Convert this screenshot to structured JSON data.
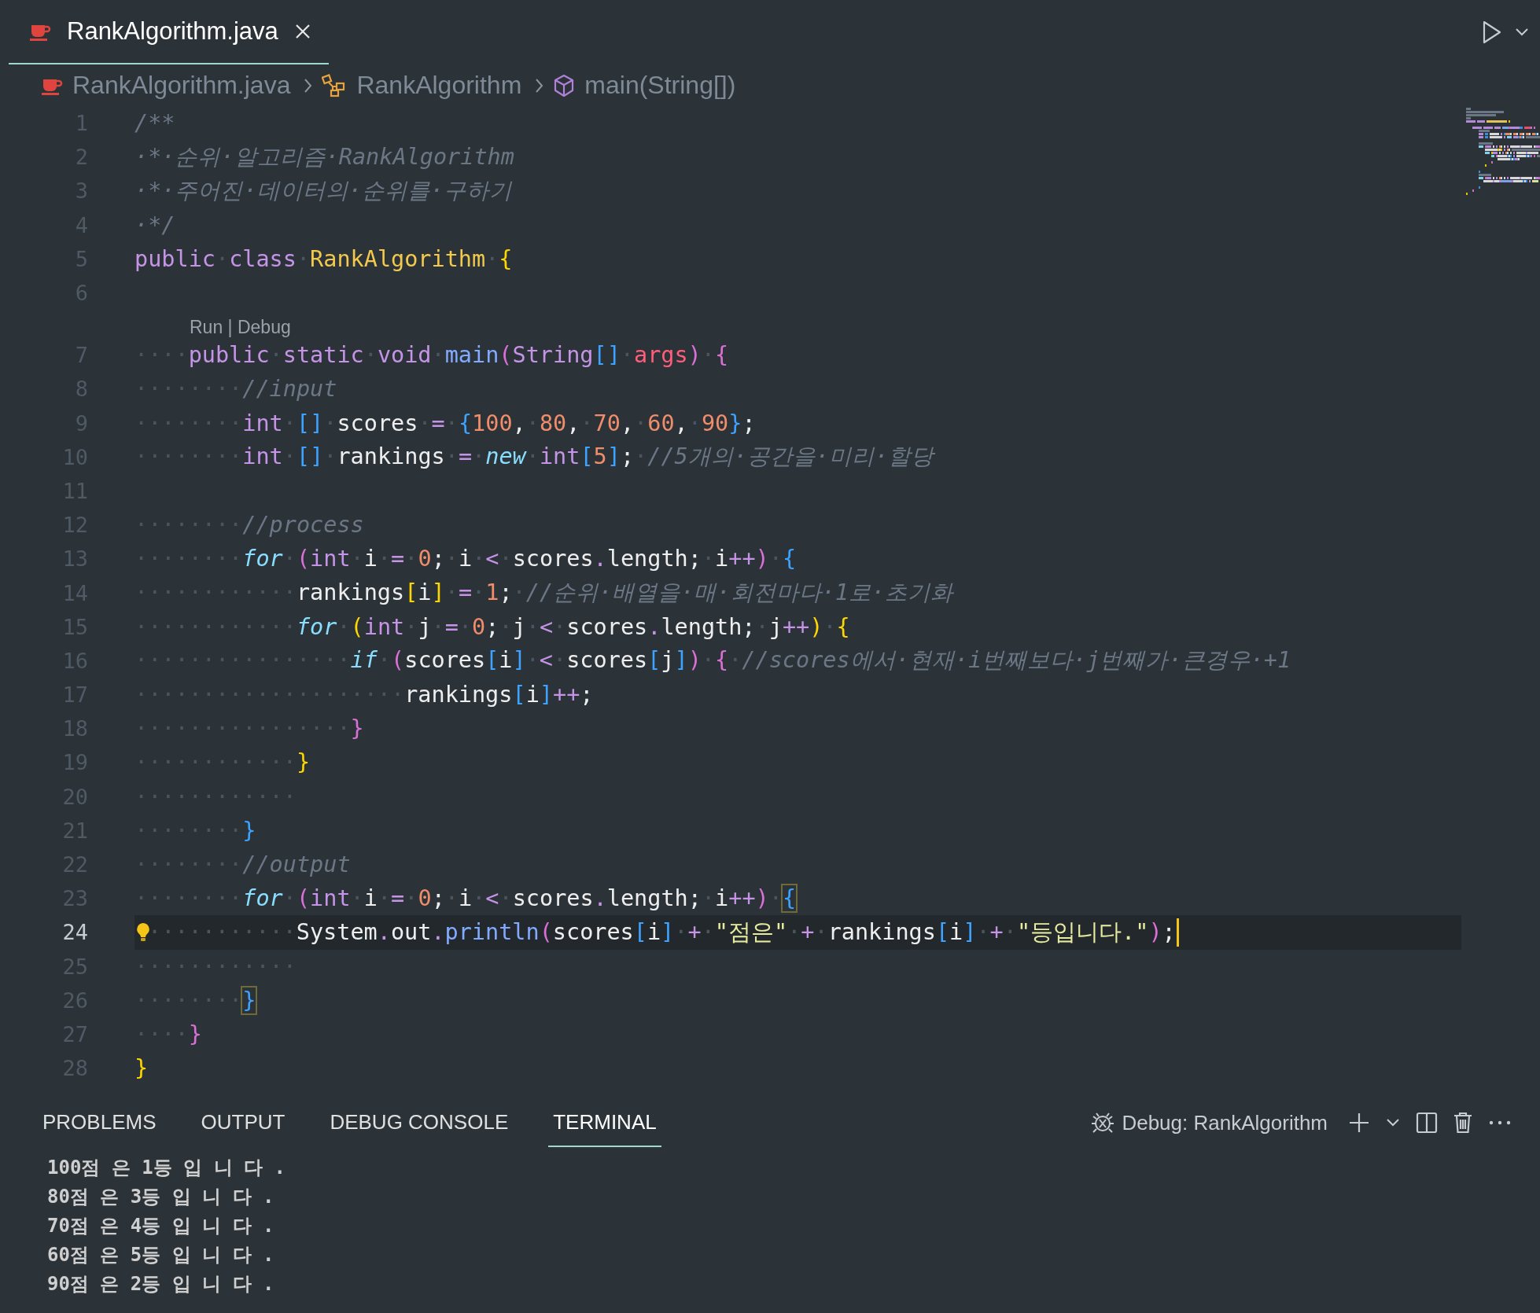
{
  "editor_tab": {
    "label": "RankAlgorithm.java",
    "selected": true
  },
  "breadcrumbs": [
    {
      "kind": "file",
      "label": "RankAlgorithm.java"
    },
    {
      "kind": "class",
      "label": "RankAlgorithm"
    },
    {
      "kind": "method",
      "label": "main(String[])"
    }
  ],
  "code_lines": [
    {
      "number": "1",
      "current": false,
      "tokens": [
        {
          "kind": "cm",
          "text": "/**"
        }
      ]
    },
    {
      "number": "2",
      "current": false,
      "tokens": [
        {
          "kind": "cm",
          "text": "·*·순위·알고리즘·RankAlgorithm"
        }
      ]
    },
    {
      "number": "3",
      "current": false,
      "tokens": [
        {
          "kind": "cm",
          "text": "·*·주어진·데이터의·순위를·구하기"
        }
      ]
    },
    {
      "number": "4",
      "current": false,
      "tokens": [
        {
          "kind": "cm",
          "text": "·*/"
        }
      ]
    },
    {
      "number": "5",
      "current": false,
      "tokens": [
        {
          "kind": "kw",
          "text": "public"
        },
        {
          "kind": "ws",
          "text": "·"
        },
        {
          "kind": "kw",
          "text": "class"
        },
        {
          "kind": "ws",
          "text": "·"
        },
        {
          "kind": "cls",
          "text": "RankAlgorithm"
        },
        {
          "kind": "ws",
          "text": "·"
        },
        {
          "kind": "b1",
          "text": "{"
        }
      ]
    },
    {
      "number": "6",
      "current": false
    },
    {
      "number": "7",
      "current": false,
      "codelens": "Run | Debug",
      "tokens": [
        {
          "kind": "ws",
          "text": "····"
        },
        {
          "kind": "kw",
          "text": "public"
        },
        {
          "kind": "ws",
          "text": "·"
        },
        {
          "kind": "kw",
          "text": "static"
        },
        {
          "kind": "ws",
          "text": "·"
        },
        {
          "kind": "kw",
          "text": "void"
        },
        {
          "kind": "ws",
          "text": "·"
        },
        {
          "kind": "fn",
          "text": "main"
        },
        {
          "kind": "b2",
          "text": "("
        },
        {
          "kind": "ty",
          "text": "String"
        },
        {
          "kind": "b3",
          "text": "[]"
        },
        {
          "kind": "ws",
          "text": "·"
        },
        {
          "kind": "par",
          "text": "args"
        },
        {
          "kind": "b2",
          "text": ")"
        },
        {
          "kind": "ws",
          "text": "·"
        },
        {
          "kind": "b2",
          "text": "{"
        }
      ]
    },
    {
      "number": "8",
      "current": false,
      "tokens": [
        {
          "kind": "ws",
          "text": "········"
        },
        {
          "kind": "cm",
          "text": "//input"
        }
      ]
    },
    {
      "number": "9",
      "current": false,
      "tokens": [
        {
          "kind": "ws",
          "text": "········"
        },
        {
          "kind": "kw",
          "text": "int"
        },
        {
          "kind": "ws",
          "text": "·"
        },
        {
          "kind": "b3",
          "text": "[]"
        },
        {
          "kind": "ws",
          "text": "·"
        },
        {
          "kind": "id",
          "text": "scores"
        },
        {
          "kind": "ws",
          "text": "·"
        },
        {
          "kind": "op",
          "text": "="
        },
        {
          "kind": "ws",
          "text": "·"
        },
        {
          "kind": "b3",
          "text": "{"
        },
        {
          "kind": "num",
          "text": "100"
        },
        {
          "kind": "id",
          "text": ","
        },
        {
          "kind": "ws",
          "text": "·"
        },
        {
          "kind": "num",
          "text": "80"
        },
        {
          "kind": "id",
          "text": ","
        },
        {
          "kind": "ws",
          "text": "·"
        },
        {
          "kind": "num",
          "text": "70"
        },
        {
          "kind": "id",
          "text": ","
        },
        {
          "kind": "ws",
          "text": "·"
        },
        {
          "kind": "num",
          "text": "60"
        },
        {
          "kind": "id",
          "text": ","
        },
        {
          "kind": "ws",
          "text": "·"
        },
        {
          "kind": "num",
          "text": "90"
        },
        {
          "kind": "b3",
          "text": "}"
        },
        {
          "kind": "id",
          "text": ";"
        }
      ]
    },
    {
      "number": "10",
      "current": false,
      "tokens": [
        {
          "kind": "ws",
          "text": "········"
        },
        {
          "kind": "kw",
          "text": "int"
        },
        {
          "kind": "ws",
          "text": "·"
        },
        {
          "kind": "b3",
          "text": "[]"
        },
        {
          "kind": "ws",
          "text": "·"
        },
        {
          "kind": "id",
          "text": "rankings"
        },
        {
          "kind": "ws",
          "text": "·"
        },
        {
          "kind": "op",
          "text": "="
        },
        {
          "kind": "ws",
          "text": "·"
        },
        {
          "kind": "it",
          "text": "new"
        },
        {
          "kind": "ws",
          "text": "·"
        },
        {
          "kind": "kw",
          "text": "int"
        },
        {
          "kind": "b3",
          "text": "["
        },
        {
          "kind": "num",
          "text": "5"
        },
        {
          "kind": "b3",
          "text": "]"
        },
        {
          "kind": "id",
          "text": ";"
        },
        {
          "kind": "ws",
          "text": "·"
        },
        {
          "kind": "cm",
          "text": "//5개의·공간을·미리·할당"
        }
      ]
    },
    {
      "number": "11",
      "current": false
    },
    {
      "number": "12",
      "current": false,
      "tokens": [
        {
          "kind": "ws",
          "text": "········"
        },
        {
          "kind": "cm",
          "text": "//process"
        }
      ]
    },
    {
      "number": "13",
      "current": false,
      "tokens": [
        {
          "kind": "ws",
          "text": "········"
        },
        {
          "kind": "it",
          "text": "for"
        },
        {
          "kind": "ws",
          "text": "·"
        },
        {
          "kind": "b2",
          "text": "("
        },
        {
          "kind": "kw",
          "text": "int"
        },
        {
          "kind": "ws",
          "text": "·"
        },
        {
          "kind": "id",
          "text": "i"
        },
        {
          "kind": "ws",
          "text": "·"
        },
        {
          "kind": "op",
          "text": "="
        },
        {
          "kind": "ws",
          "text": "·"
        },
        {
          "kind": "num",
          "text": "0"
        },
        {
          "kind": "id",
          "text": ";"
        },
        {
          "kind": "ws",
          "text": "·"
        },
        {
          "kind": "id",
          "text": "i"
        },
        {
          "kind": "ws",
          "text": "·"
        },
        {
          "kind": "op",
          "text": "<"
        },
        {
          "kind": "ws",
          "text": "·"
        },
        {
          "kind": "id",
          "text": "scores"
        },
        {
          "kind": "op",
          "text": "."
        },
        {
          "kind": "id",
          "text": "length"
        },
        {
          "kind": "id",
          "text": ";"
        },
        {
          "kind": "ws",
          "text": "·"
        },
        {
          "kind": "id",
          "text": "i"
        },
        {
          "kind": "op",
          "text": "++"
        },
        {
          "kind": "b2",
          "text": ")"
        },
        {
          "kind": "ws",
          "text": "·"
        },
        {
          "kind": "b3",
          "text": "{"
        }
      ]
    },
    {
      "number": "14",
      "current": false,
      "tokens": [
        {
          "kind": "ws",
          "text": "············"
        },
        {
          "kind": "id",
          "text": "rankings"
        },
        {
          "kind": "b1",
          "text": "["
        },
        {
          "kind": "id",
          "text": "i"
        },
        {
          "kind": "b1",
          "text": "]"
        },
        {
          "kind": "ws",
          "text": "·"
        },
        {
          "kind": "op",
          "text": "="
        },
        {
          "kind": "ws",
          "text": "·"
        },
        {
          "kind": "num",
          "text": "1"
        },
        {
          "kind": "id",
          "text": ";"
        },
        {
          "kind": "ws",
          "text": "·"
        },
        {
          "kind": "cm",
          "text": "//순위·배열을·매·회전마다·1로·초기화"
        }
      ]
    },
    {
      "number": "15",
      "current": false,
      "tokens": [
        {
          "kind": "ws",
          "text": "············"
        },
        {
          "kind": "it",
          "text": "for"
        },
        {
          "kind": "ws",
          "text": "·"
        },
        {
          "kind": "b1",
          "text": "("
        },
        {
          "kind": "kw",
          "text": "int"
        },
        {
          "kind": "ws",
          "text": "·"
        },
        {
          "kind": "id",
          "text": "j"
        },
        {
          "kind": "ws",
          "text": "·"
        },
        {
          "kind": "op",
          "text": "="
        },
        {
          "kind": "ws",
          "text": "·"
        },
        {
          "kind": "num",
          "text": "0"
        },
        {
          "kind": "id",
          "text": ";"
        },
        {
          "kind": "ws",
          "text": "·"
        },
        {
          "kind": "id",
          "text": "j"
        },
        {
          "kind": "ws",
          "text": "·"
        },
        {
          "kind": "op",
          "text": "<"
        },
        {
          "kind": "ws",
          "text": "·"
        },
        {
          "kind": "id",
          "text": "scores"
        },
        {
          "kind": "op",
          "text": "."
        },
        {
          "kind": "id",
          "text": "length"
        },
        {
          "kind": "id",
          "text": ";"
        },
        {
          "kind": "ws",
          "text": "·"
        },
        {
          "kind": "id",
          "text": "j"
        },
        {
          "kind": "op",
          "text": "++"
        },
        {
          "kind": "b1",
          "text": ")"
        },
        {
          "kind": "ws",
          "text": "·"
        },
        {
          "kind": "b1",
          "text": "{"
        }
      ]
    },
    {
      "number": "16",
      "current": false,
      "tokens": [
        {
          "kind": "ws",
          "text": "················"
        },
        {
          "kind": "it",
          "text": "if"
        },
        {
          "kind": "ws",
          "text": "·"
        },
        {
          "kind": "b2",
          "text": "("
        },
        {
          "kind": "id",
          "text": "scores"
        },
        {
          "kind": "b3",
          "text": "["
        },
        {
          "kind": "id",
          "text": "i"
        },
        {
          "kind": "b3",
          "text": "]"
        },
        {
          "kind": "ws",
          "text": "·"
        },
        {
          "kind": "op",
          "text": "<"
        },
        {
          "kind": "ws",
          "text": "·"
        },
        {
          "kind": "id",
          "text": "scores"
        },
        {
          "kind": "b3",
          "text": "["
        },
        {
          "kind": "id",
          "text": "j"
        },
        {
          "kind": "b3",
          "text": "]"
        },
        {
          "kind": "b2",
          "text": ")"
        },
        {
          "kind": "ws",
          "text": "·"
        },
        {
          "kind": "b2",
          "text": "{"
        },
        {
          "kind": "ws",
          "text": "·"
        },
        {
          "kind": "cm",
          "text": "//scores에서·현재·i번째보다·j번째가·큰경우·+1"
        }
      ]
    },
    {
      "number": "17",
      "current": false,
      "tokens": [
        {
          "kind": "ws",
          "text": "····················"
        },
        {
          "kind": "id",
          "text": "rankings"
        },
        {
          "kind": "b3",
          "text": "["
        },
        {
          "kind": "id",
          "text": "i"
        },
        {
          "kind": "b3",
          "text": "]"
        },
        {
          "kind": "op",
          "text": "++"
        },
        {
          "kind": "id",
          "text": ";"
        }
      ]
    },
    {
      "number": "18",
      "current": false,
      "tokens": [
        {
          "kind": "ws",
          "text": "················"
        },
        {
          "kind": "b2",
          "text": "}"
        }
      ]
    },
    {
      "number": "19",
      "current": false,
      "tokens": [
        {
          "kind": "ws",
          "text": "············"
        },
        {
          "kind": "b1",
          "text": "}"
        }
      ]
    },
    {
      "number": "20",
      "current": false,
      "tokens": [
        {
          "kind": "ws",
          "text": "············"
        }
      ]
    },
    {
      "number": "21",
      "current": false,
      "tokens": [
        {
          "kind": "ws",
          "text": "········"
        },
        {
          "kind": "b3",
          "text": "}"
        }
      ]
    },
    {
      "number": "22",
      "current": false,
      "tokens": [
        {
          "kind": "ws",
          "text": "········"
        },
        {
          "kind": "cm",
          "text": "//output"
        }
      ]
    },
    {
      "number": "23",
      "current": false,
      "tokens": [
        {
          "kind": "ws",
          "text": "········"
        },
        {
          "kind": "it",
          "text": "for"
        },
        {
          "kind": "ws",
          "text": "·"
        },
        {
          "kind": "b2",
          "text": "("
        },
        {
          "kind": "kw",
          "text": "int"
        },
        {
          "kind": "ws",
          "text": "·"
        },
        {
          "kind": "id",
          "text": "i"
        },
        {
          "kind": "ws",
          "text": "·"
        },
        {
          "kind": "op",
          "text": "="
        },
        {
          "kind": "ws",
          "text": "·"
        },
        {
          "kind": "num",
          "text": "0"
        },
        {
          "kind": "id",
          "text": ";"
        },
        {
          "kind": "ws",
          "text": "·"
        },
        {
          "kind": "id",
          "text": "i"
        },
        {
          "kind": "ws",
          "text": "·"
        },
        {
          "kind": "op",
          "text": "<"
        },
        {
          "kind": "ws",
          "text": "·"
        },
        {
          "kind": "id",
          "text": "scores"
        },
        {
          "kind": "op",
          "text": "."
        },
        {
          "kind": "id",
          "text": "length"
        },
        {
          "kind": "id",
          "text": ";"
        },
        {
          "kind": "ws",
          "text": "·"
        },
        {
          "kind": "id",
          "text": "i"
        },
        {
          "kind": "op",
          "text": "++"
        },
        {
          "kind": "b2",
          "text": ")"
        },
        {
          "kind": "ws",
          "text": "·"
        },
        {
          "kind": "b3m",
          "text": "{"
        }
      ]
    },
    {
      "number": "24",
      "current": true,
      "lightbulb": true,
      "tokens": [
        {
          "kind": "ws",
          "text": "···········"
        },
        {
          "kind": "id",
          "text": "System"
        },
        {
          "kind": "op",
          "text": "."
        },
        {
          "kind": "id",
          "text": "out"
        },
        {
          "kind": "op",
          "text": "."
        },
        {
          "kind": "fn",
          "text": "println"
        },
        {
          "kind": "b2",
          "text": "("
        },
        {
          "kind": "id",
          "text": "scores"
        },
        {
          "kind": "b3",
          "text": "["
        },
        {
          "kind": "id",
          "text": "i"
        },
        {
          "kind": "b3",
          "text": "]"
        },
        {
          "kind": "ws",
          "text": "·"
        },
        {
          "kind": "op",
          "text": "+"
        },
        {
          "kind": "ws",
          "text": "·"
        },
        {
          "kind": "str",
          "text": "\"점은\""
        },
        {
          "kind": "ws",
          "text": "·"
        },
        {
          "kind": "op",
          "text": "+"
        },
        {
          "kind": "ws",
          "text": "·"
        },
        {
          "kind": "id",
          "text": "rankings"
        },
        {
          "kind": "b3",
          "text": "["
        },
        {
          "kind": "id",
          "text": "i"
        },
        {
          "kind": "b3",
          "text": "]"
        },
        {
          "kind": "ws",
          "text": "·"
        },
        {
          "kind": "op",
          "text": "+"
        },
        {
          "kind": "ws",
          "text": "·"
        },
        {
          "kind": "str",
          "text": "\"등입니다.\""
        },
        {
          "kind": "b2",
          "text": ")"
        },
        {
          "kind": "id",
          "text": ";"
        }
      ]
    },
    {
      "number": "25",
      "current": false,
      "tokens": [
        {
          "kind": "ws",
          "text": "············"
        }
      ]
    },
    {
      "number": "26",
      "current": false,
      "tokens": [
        {
          "kind": "ws",
          "text": "········"
        },
        {
          "kind": "b3m",
          "text": "}"
        }
      ]
    },
    {
      "number": "27",
      "current": false,
      "tokens": [
        {
          "kind": "ws",
          "text": "····"
        },
        {
          "kind": "b2",
          "text": "}"
        }
      ]
    },
    {
      "number": "28",
      "current": false,
      "tokens": [
        {
          "kind": "b1",
          "text": "}"
        }
      ]
    }
  ],
  "panel": {
    "tabs": [
      {
        "label": "PROBLEMS",
        "selected": false
      },
      {
        "label": "OUTPUT",
        "selected": false
      },
      {
        "label": "DEBUG CONSOLE",
        "selected": false
      },
      {
        "label": "TERMINAL",
        "selected": true
      }
    ],
    "terminal_name": "Debug: RankAlgorithm",
    "terminal_lines": [
      "100점 은 1등 입 니 다 .",
      "80점 은 3등 입 니 다 .",
      "70점 은 4등 입 니 다 .",
      "60점 은 5등 입 니 다 .",
      "90점 은 2등 입 니 다 ."
    ]
  }
}
